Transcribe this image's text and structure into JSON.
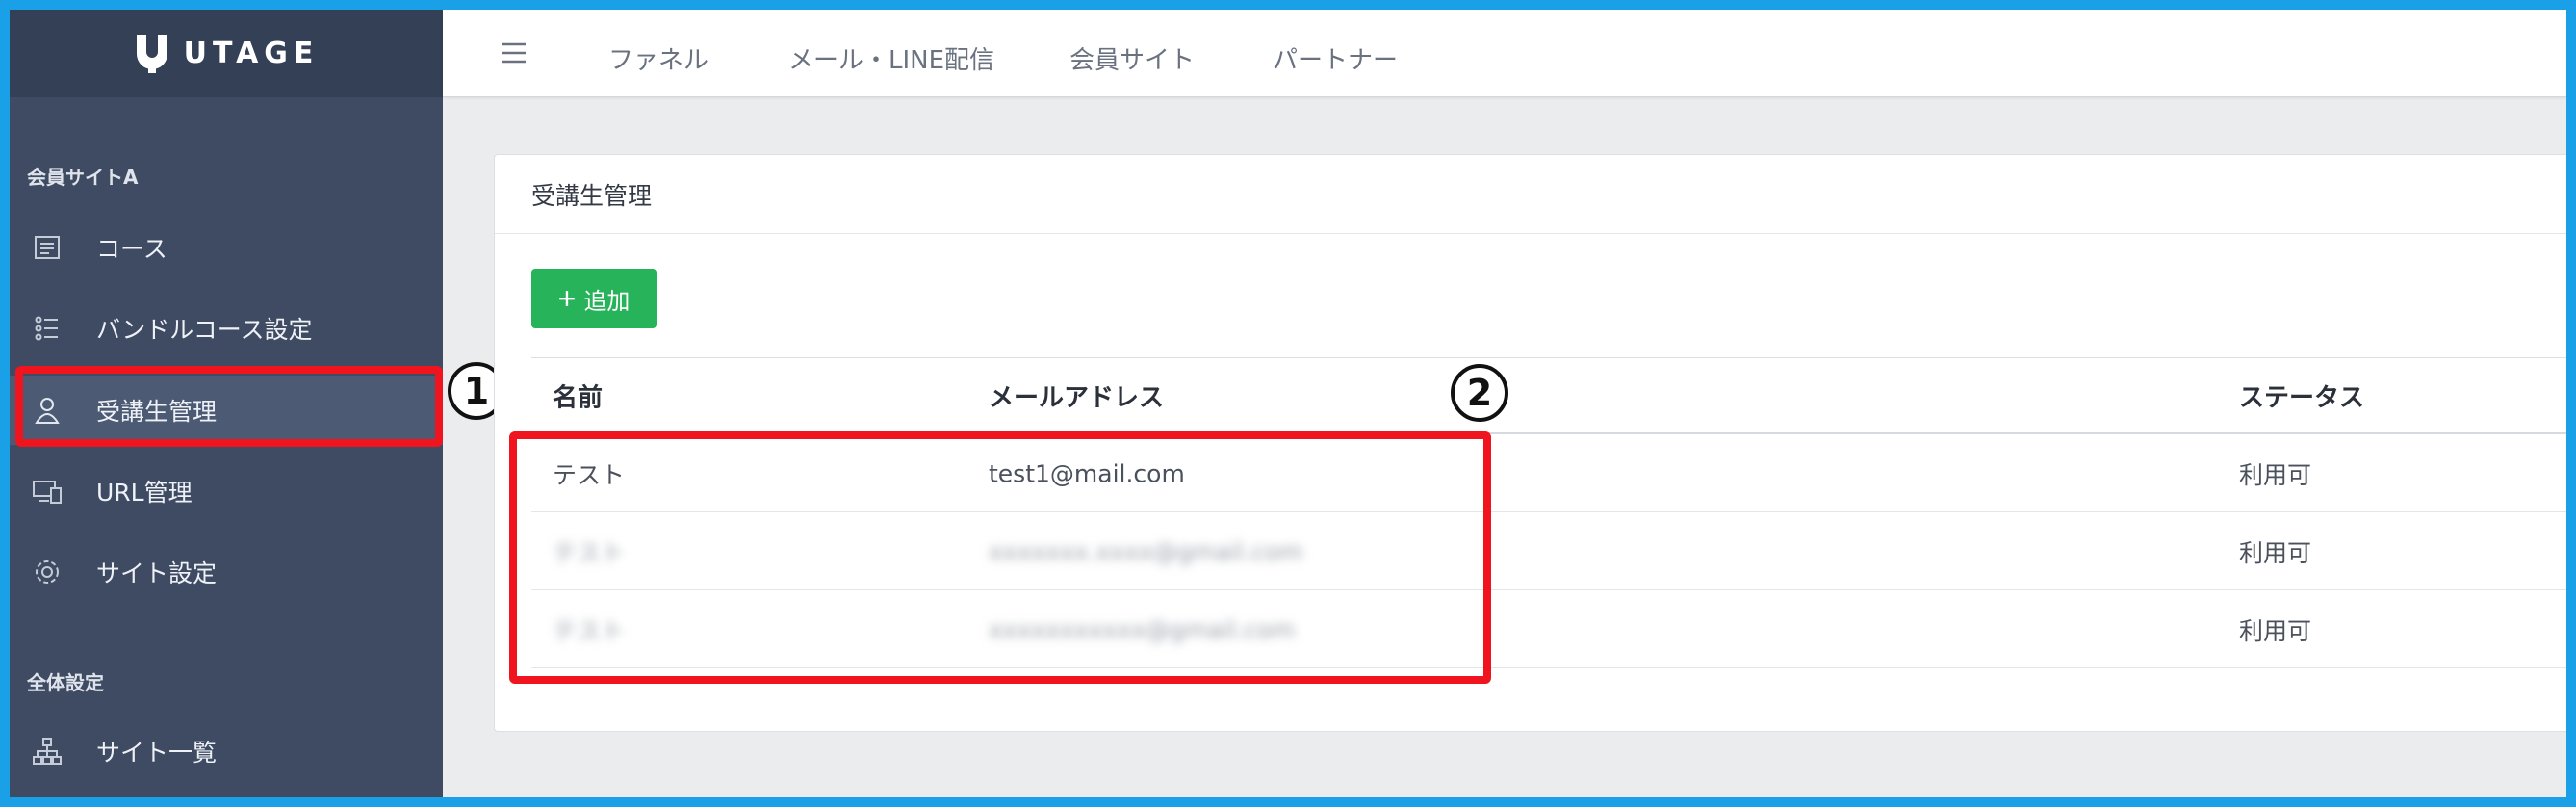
{
  "brand": {
    "name": "UTAGE"
  },
  "sidebar": {
    "section1_title": "会員サイトA",
    "items": [
      {
        "label": "コース",
        "icon": "document-icon"
      },
      {
        "label": "バンドルコース設定",
        "icon": "list-icon"
      },
      {
        "label": "受講生管理",
        "icon": "user-icon",
        "active": true
      },
      {
        "label": "URL管理",
        "icon": "devices-icon"
      },
      {
        "label": "サイト設定",
        "icon": "gear-icon"
      }
    ],
    "section2_title": "全体設定",
    "items2": [
      {
        "label": "サイト一覧",
        "icon": "sitemap-icon"
      }
    ]
  },
  "topnav": {
    "items": [
      "ファネル",
      "メール・LINE配信",
      "会員サイト",
      "パートナー"
    ]
  },
  "card": {
    "title": "受講生管理",
    "add_label": "追加",
    "columns": {
      "name": "名前",
      "email": "メールアドレス",
      "status": "ステータス"
    },
    "rows": [
      {
        "name": "テスト",
        "email": "test1@mail.com",
        "status": "利用可"
      },
      {
        "name": "テスト",
        "email": "xxxxxxx.xxxx@gmail.com",
        "status": "利用可"
      },
      {
        "name": "テスト",
        "email": "xxxxxxxxxxx@gmail.com",
        "status": "利用可"
      }
    ]
  },
  "annotations": {
    "marker1": "1",
    "marker2": "2"
  },
  "colors": {
    "highlight": "#f0141e",
    "accent_green": "#27b35a",
    "sidebar": "#3e4b63",
    "frame": "#1aa0e6"
  }
}
